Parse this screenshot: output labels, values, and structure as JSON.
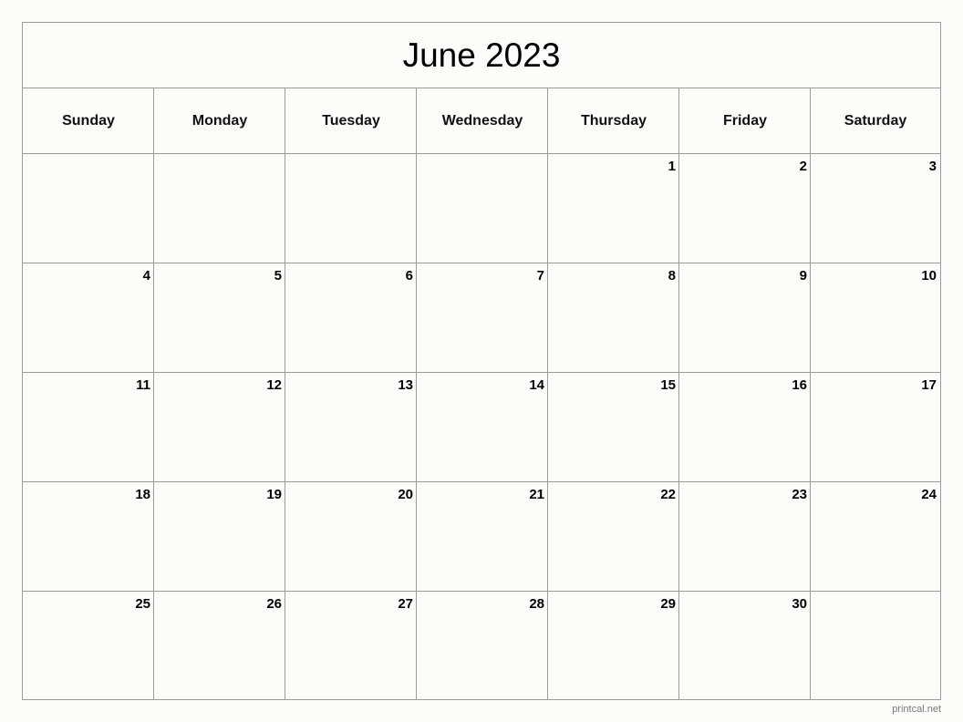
{
  "title": "June 2023",
  "weekdays": [
    "Sunday",
    "Monday",
    "Tuesday",
    "Wednesday",
    "Thursday",
    "Friday",
    "Saturday"
  ],
  "weeks": [
    [
      "",
      "",
      "",
      "",
      "1",
      "2",
      "3"
    ],
    [
      "4",
      "5",
      "6",
      "7",
      "8",
      "9",
      "10"
    ],
    [
      "11",
      "12",
      "13",
      "14",
      "15",
      "16",
      "17"
    ],
    [
      "18",
      "19",
      "20",
      "21",
      "22",
      "23",
      "24"
    ],
    [
      "25",
      "26",
      "27",
      "28",
      "29",
      "30",
      ""
    ]
  ],
  "credit": "printcal.net"
}
